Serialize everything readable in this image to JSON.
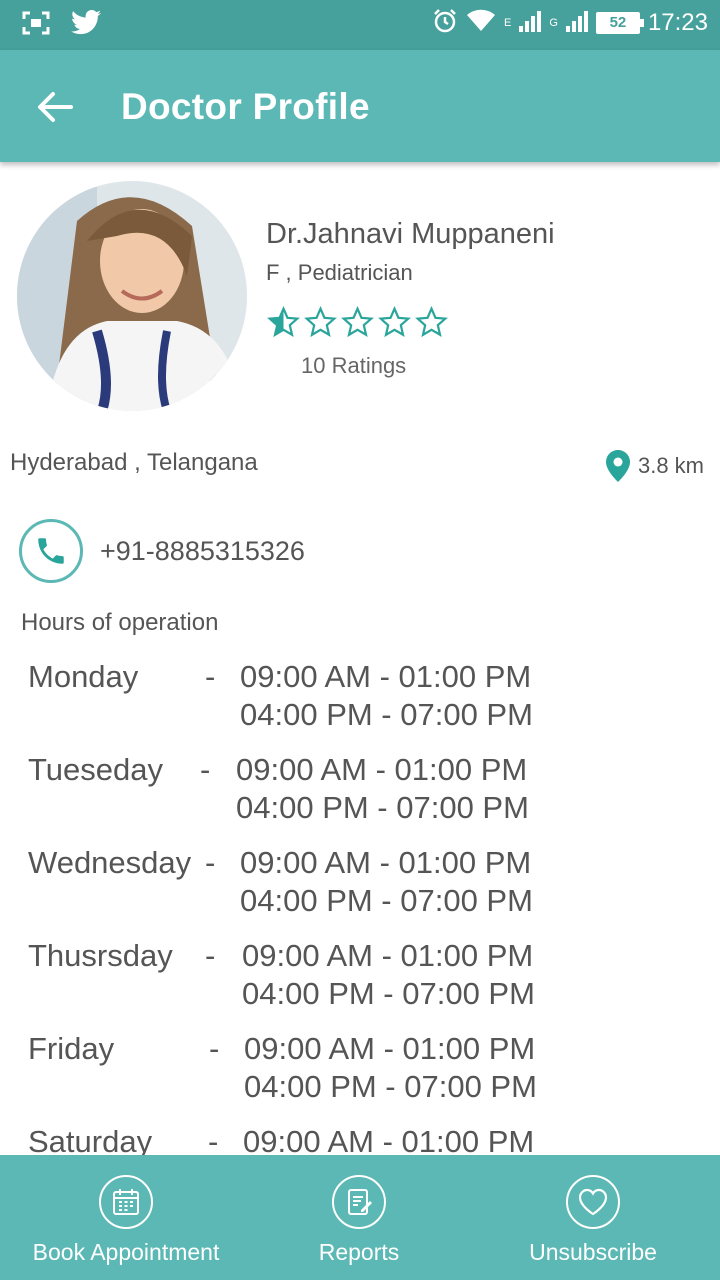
{
  "status_bar": {
    "time": "17:23",
    "battery": "52",
    "network_1": "E",
    "network_2": "G"
  },
  "app_bar": {
    "title": "Doctor Profile",
    "back_icon": "arrow-back-icon"
  },
  "profile": {
    "name": "Dr.Jahnavi Muppaneni",
    "subtitle": "F , Pediatrician",
    "rating_value": 0.5,
    "rating_max": 5,
    "ratings_count": "10 Ratings",
    "location": "Hyderabad , Telangana",
    "distance": "3.8 km",
    "phone": "+91-8885315326"
  },
  "hours": {
    "title": "Hours of operation",
    "separator": "-",
    "days": [
      {
        "day": "Monday",
        "slots": [
          "09:00 AM - 01:00 PM",
          "04:00 PM - 07:00 PM"
        ]
      },
      {
        "day": "Tueseday",
        "slots": [
          "09:00 AM - 01:00 PM",
          "04:00 PM - 07:00 PM"
        ]
      },
      {
        "day": "Wednesday",
        "slots": [
          "09:00 AM - 01:00 PM",
          "04:00 PM - 07:00 PM"
        ]
      },
      {
        "day": "Thusrsday",
        "slots": [
          "09:00 AM - 01:00 PM",
          "04:00 PM - 07:00 PM"
        ]
      },
      {
        "day": "Friday",
        "slots": [
          "09:00 AM - 01:00 PM",
          "04:00 PM - 07:00 PM"
        ]
      },
      {
        "day": "Saturday",
        "slots": [
          "09:00 AM - 01:00 PM"
        ]
      }
    ]
  },
  "bottom_nav": {
    "book_label": "Book Appointment",
    "reports_label": "Reports",
    "unsubscribe_label": "Unsubscribe"
  },
  "colors": {
    "primary": "#5bb8b4",
    "status_bar": "#46a09b",
    "accent": "#2aa59b"
  }
}
